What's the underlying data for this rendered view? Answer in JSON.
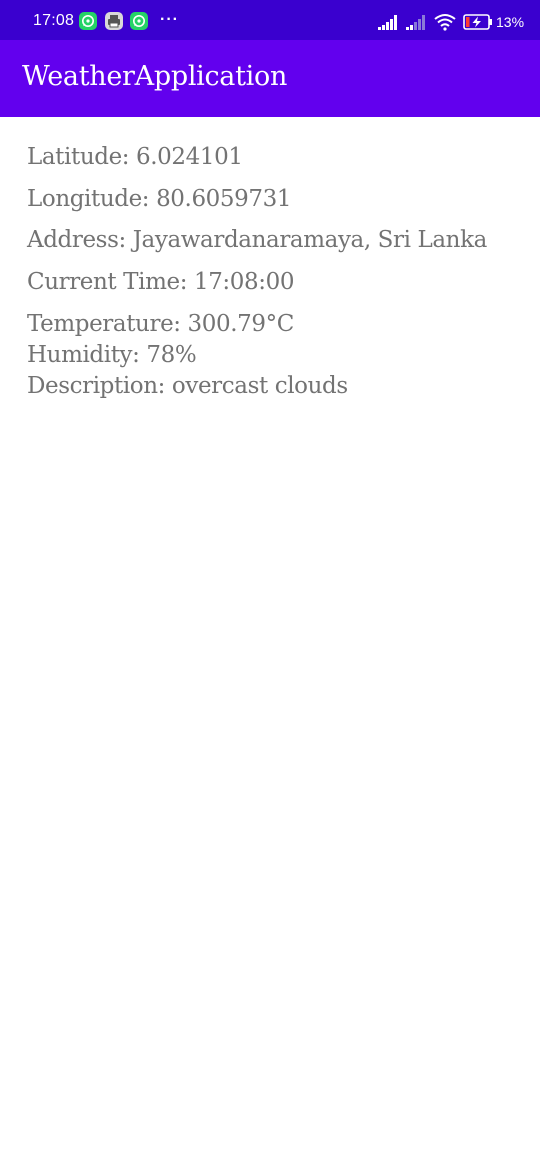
{
  "status_bar": {
    "time": "17:08",
    "battery_percent": "13%",
    "colors": {
      "background": "#3a00cf",
      "whatsapp": "#25d366"
    },
    "icons": [
      "whatsapp-icon",
      "printer-notification-icon",
      "whatsapp-icon",
      "more-notifications-icon",
      "signal-icon",
      "signal-icon",
      "wifi-icon",
      "battery-charging-icon"
    ]
  },
  "app_bar": {
    "title": "WeatherApplication",
    "color": "#6200ee"
  },
  "weather": {
    "latitude": "Latitude: 6.024101",
    "longitude": "Longitude: 80.6059731",
    "address": "Address: Jayawardanaramaya, Sri Lanka",
    "current_time": "Current Time: 17:08:00",
    "temperature": "Temperature: 300.79°C",
    "humidity": "Humidity: 78%",
    "description": "Description: overcast clouds"
  }
}
